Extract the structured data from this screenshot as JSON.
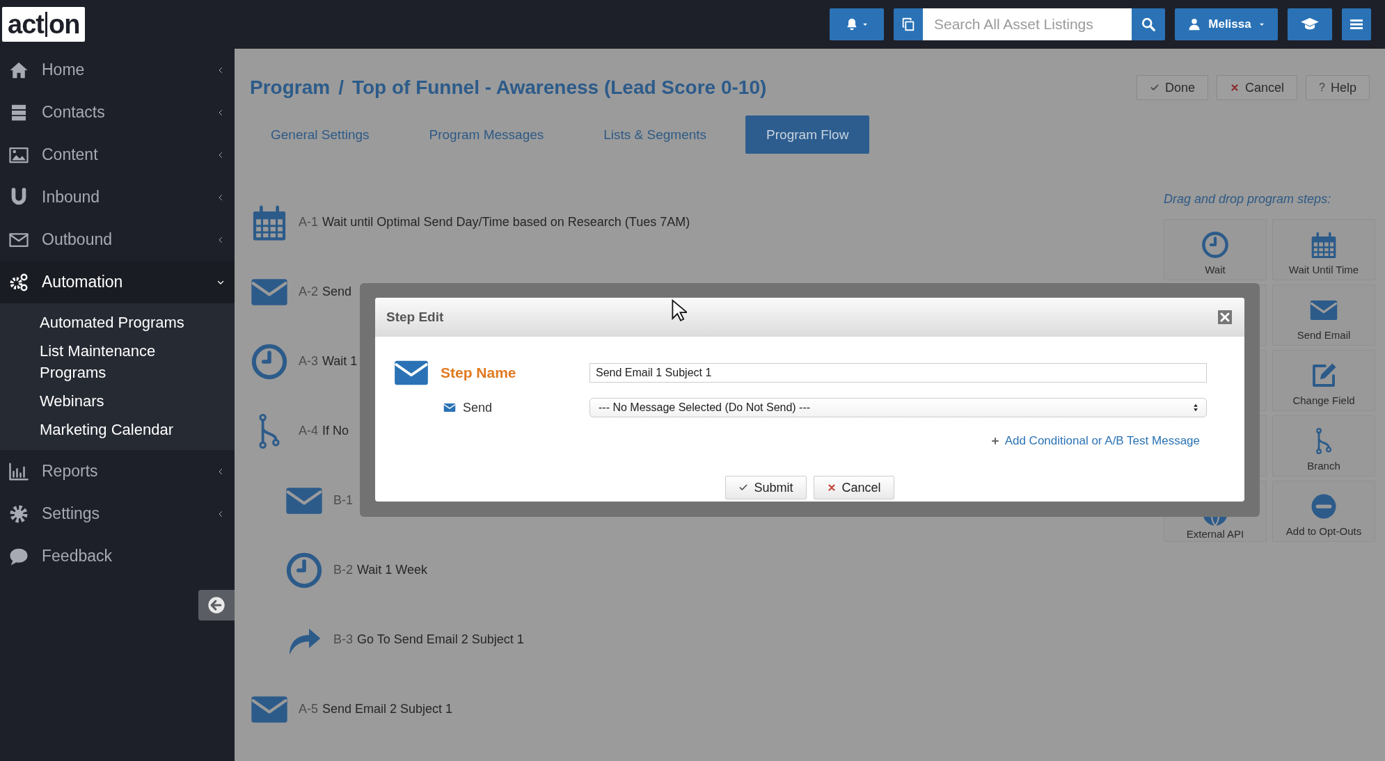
{
  "topbar": {
    "logo": {
      "left": "act",
      "right": "on"
    },
    "search": {
      "placeholder": "Search All Asset Listings"
    },
    "user": "Melissa"
  },
  "sidebar": {
    "items": [
      {
        "label": "Home",
        "kind": "menu",
        "selected": false,
        "expanded": false
      },
      {
        "label": "Contacts",
        "kind": "menu",
        "selected": false,
        "expanded": false
      },
      {
        "label": "Content",
        "kind": "menu",
        "selected": false,
        "expanded": false
      },
      {
        "label": "Inbound",
        "kind": "menu",
        "selected": false,
        "expanded": false
      },
      {
        "label": "Outbound",
        "kind": "menu",
        "selected": false,
        "expanded": false
      },
      {
        "label": "Automation",
        "kind": "menu",
        "selected": true,
        "expanded": true,
        "children": [
          {
            "label": "Automated Programs",
            "selected": false
          },
          {
            "label": "List Maintenance Programs",
            "selected": false
          },
          {
            "label": "Webinars",
            "selected": false
          },
          {
            "label": "Marketing Calendar",
            "selected": false
          }
        ]
      },
      {
        "label": "Reports",
        "kind": "menu",
        "selected": false,
        "expanded": false
      },
      {
        "label": "Settings",
        "kind": "menu",
        "selected": false,
        "expanded": false
      },
      {
        "label": "Feedback",
        "kind": "link",
        "selected": false
      }
    ]
  },
  "page": {
    "breadcrumb": [
      "Program",
      "Top of Funnel - Awareness (Lead Score 0-10)"
    ],
    "separator": "/",
    "actions": [
      {
        "label": "Done",
        "kind": "check"
      },
      {
        "label": "Cancel",
        "kind": "cross"
      },
      {
        "label": "Help",
        "kind": "glyph",
        "glyph": "?"
      }
    ],
    "tabs": [
      {
        "label": "General Settings",
        "selected": false
      },
      {
        "label": "Program Messages",
        "selected": false
      },
      {
        "label": "Lists & Segments",
        "selected": false
      },
      {
        "label": "Program Flow",
        "selected": true
      }
    ]
  },
  "flow": {
    "steps": [
      {
        "code": "A-1",
        "text": "Wait until Optimal Send Day/Time based on Research (Tues 7AM)",
        "kind": "calendar"
      },
      {
        "code": "A-2",
        "text": "Send",
        "kind": "email"
      },
      {
        "code": "A-3",
        "text": "Wait 1",
        "kind": "clock"
      },
      {
        "code": "A-4",
        "text": "If No",
        "kind": "branch",
        "children": [
          {
            "code": "B-1",
            "kind": "email"
          },
          {
            "code": "B-2",
            "text": "Wait 1 Week",
            "kind": "clock"
          },
          {
            "code": "B-3",
            "text": "Go To Send Email 2 Subject 1",
            "kind": "goto"
          }
        ]
      },
      {
        "code": "A-5",
        "text": "Send Email 2 Subject 1",
        "kind": "email"
      }
    ]
  },
  "palette": {
    "title": "Drag and drop program steps:",
    "rows": [
      {
        "left": {
          "label": "Wait",
          "kind": "clock"
        },
        "right": {
          "label": "Wait Until Time",
          "kind": "calendar"
        }
      },
      {
        "right": {
          "label": "Send Email",
          "kind": "email"
        }
      },
      {
        "right": {
          "label": "Change Field",
          "kind": "edit"
        }
      },
      {
        "right": {
          "label": "Branch",
          "kind": "branch"
        }
      },
      {
        "left": {
          "label": "External API",
          "kind": "globe"
        },
        "right": {
          "label": "Add to Opt-Outs",
          "kind": "minus"
        }
      }
    ]
  },
  "dialog": {
    "title": "Step Edit",
    "step_name_label": "Step Name",
    "step_name_value": "Send Email 1 Subject 1",
    "send_label": "Send",
    "send_value": "--- No Message Selected (Do Not Send) ---",
    "link": "Add Conditional or A/B Test Message",
    "buttons": [
      {
        "label": "Submit",
        "kind": "check"
      },
      {
        "label": "Cancel",
        "kind": "cross"
      }
    ]
  }
}
